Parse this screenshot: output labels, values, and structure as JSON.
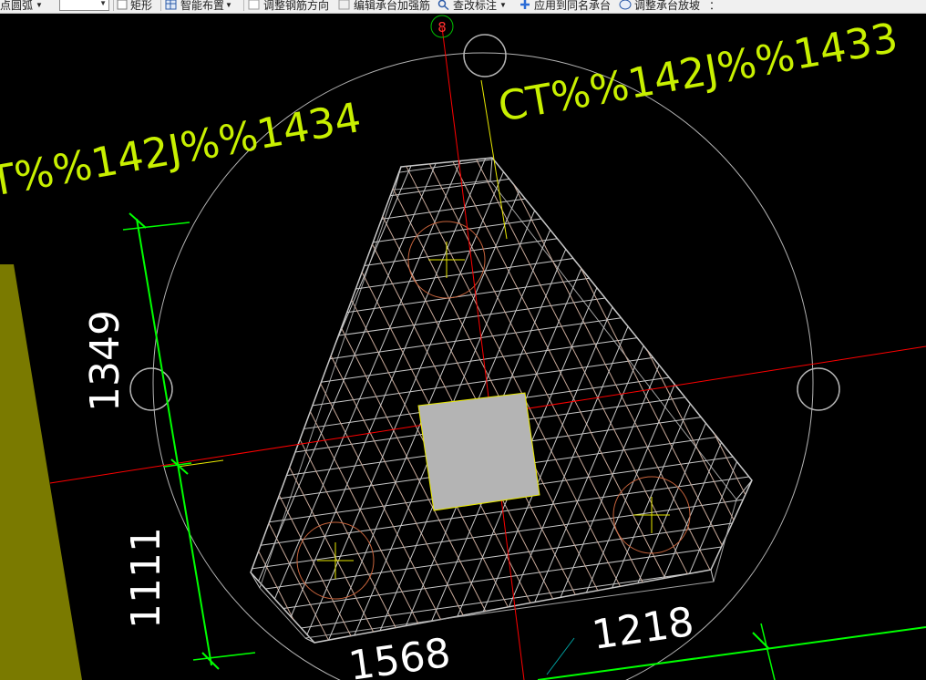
{
  "toolbar": {
    "arc_item": "点圆弧",
    "rect_label": "矩形",
    "smart_layout_label": "智能布置",
    "adjust_rebar_label": "调整钢筋方向",
    "edit_rebar_label": "编辑承台加强筋",
    "view_annotation_label": "查改标注",
    "apply_same_label": "应用到同名承台",
    "adjust_slope_label": "调整承台放坡",
    "more_glyph": "："
  },
  "drawing": {
    "axis_label": "8",
    "label_left": "T%%142J%%1434",
    "label_right": "CT%%142J%%1433",
    "dim_left_upper": "1349",
    "dim_left_lower": "1111",
    "dim_bottom_left": "1568",
    "dim_bottom_right": "1218"
  },
  "colors": {
    "background": "#000000",
    "dimension_line": "#00ff00",
    "axis_line": "#ff0000",
    "rebar": "#c8c8c8",
    "label": "#c8f000",
    "column": "#b4b4b4",
    "wall": "#7a7a00"
  }
}
